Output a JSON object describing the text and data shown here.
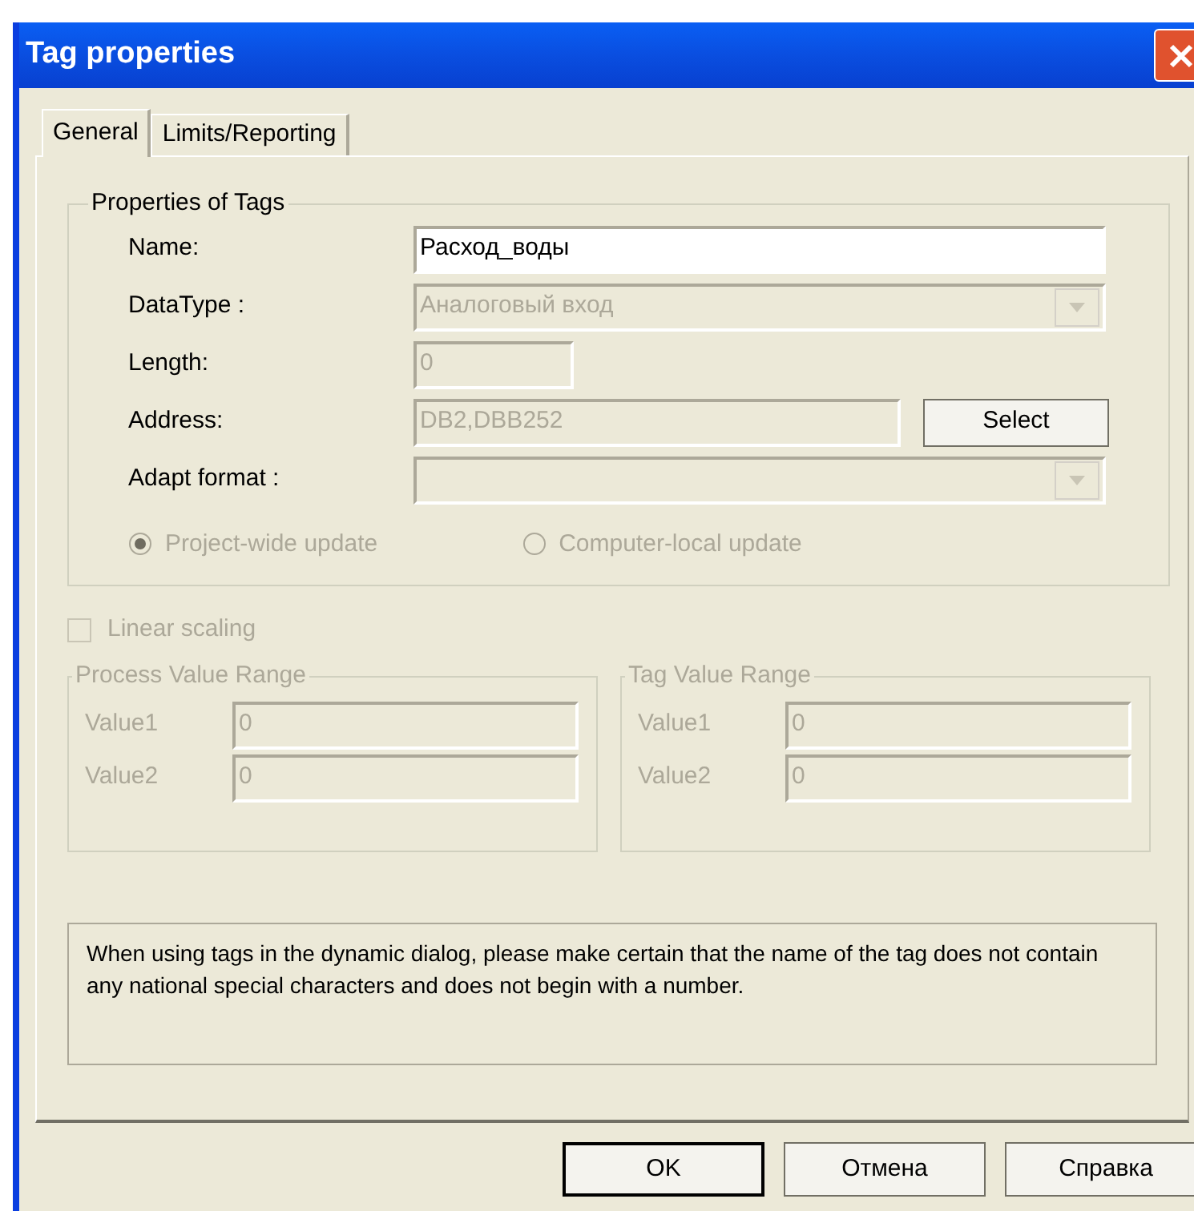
{
  "window": {
    "title": "Tag properties"
  },
  "tabs": [
    {
      "label": "General",
      "selected": true
    },
    {
      "label": "Limits/Reporting",
      "selected": false
    }
  ],
  "properties_group": {
    "title": "Properties of Tags",
    "fields": [
      {
        "kind": "text",
        "label": "Name:",
        "value": "Расход_воды",
        "disabled": false
      },
      {
        "kind": "dropdown",
        "label": "DataType :",
        "value": "Аналоговый вход",
        "disabled": true
      },
      {
        "kind": "short_text",
        "label": "Length:",
        "value": "0",
        "disabled": true
      },
      {
        "kind": "text_button",
        "label": "Address:",
        "value": "DB2,DBB252",
        "disabled": true,
        "button": "Select"
      },
      {
        "kind": "dropdown",
        "label": "Adapt format :",
        "disabled": true
      }
    ],
    "update_options": [
      {
        "label": "Project-wide update",
        "selected": true,
        "disabled": true
      },
      {
        "label": "Computer-local update",
        "selected": false,
        "disabled": true
      }
    ]
  },
  "linear_scaling": {
    "label": "Linear scaling",
    "checked": false,
    "disabled": true
  },
  "ranges": [
    {
      "title": "Process Value Range",
      "disabled": true,
      "rows": [
        {
          "label": "Value1",
          "value": "0"
        },
        {
          "label": "Value2",
          "value": "0"
        }
      ]
    },
    {
      "title": "Tag Value Range",
      "disabled": true,
      "rows": [
        {
          "label": "Value1",
          "value": "0"
        },
        {
          "label": "Value2",
          "value": "0"
        }
      ]
    }
  ],
  "note": "When using tags in the dynamic dialog, please make certain that the name of the tag does not contain any national special characters and does not begin with a number.",
  "buttons": [
    {
      "label": "OK",
      "default": true
    },
    {
      "label": "Отмена",
      "default": false
    },
    {
      "label": "Справка",
      "default": false
    }
  ]
}
